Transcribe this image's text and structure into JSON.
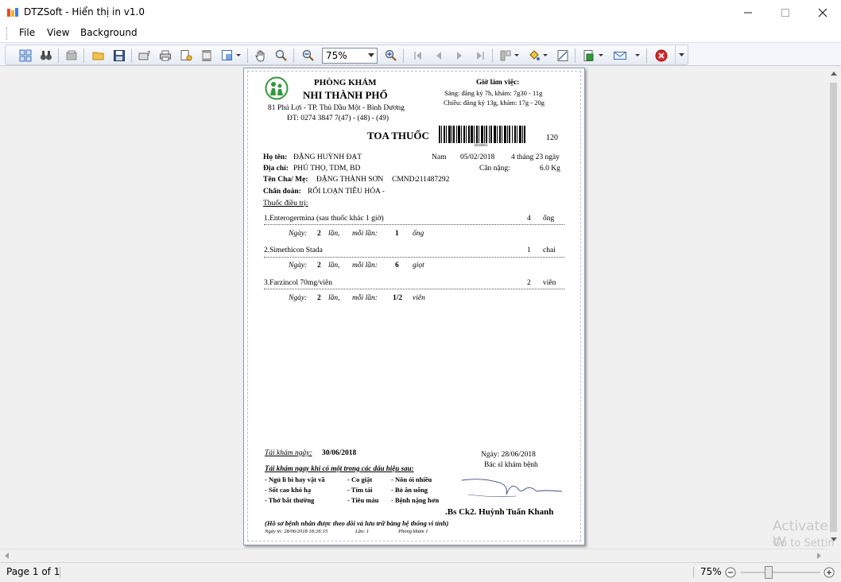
{
  "window": {
    "title": "DTZSoft - Hiển thị in v1.0"
  },
  "menu": {
    "file": "File",
    "view": "View",
    "background": "Background"
  },
  "toolbar": {
    "zoom_value": "75%"
  },
  "clinic": {
    "line1": "PHÒNG KHÁM",
    "line2": "NHI THÀNH PHỐ",
    "address": "81 Phú Lợi - TP. Thủ Dầu Một - Bình Dương",
    "phone": "ĐT: 0274 3847 7(47) - (48) - (49)",
    "hours_title": "Giờ làm việc:",
    "hours_morning": "Sáng: đăng ký 7h, khám: 7g30 - 11g",
    "hours_afternoon": "Chiều: đăng ký 13g, khám: 17g - 20g"
  },
  "prescription": {
    "title": "TOA THUỐC",
    "barcode_text": "1816661",
    "number": "120"
  },
  "patient": {
    "name_label": "Họ tên:",
    "name": "ĐẶNG HUỲNH ĐẠT",
    "gender": "Nam",
    "dob": "05/02/2018",
    "age": "4 tháng 23 ngày",
    "address_label": "Địa chỉ:",
    "address": "PHÚ THỌ, TDM, BD",
    "weight_label": "Cân nặng:",
    "weight": "6.0 Kg",
    "parent_label": "Tên Cha/ Mẹ:",
    "parent": "ĐẶNG THÀNH SƠN",
    "id_label": "CMND:",
    "id": "211487292",
    "diagnosis_label": "Chẩn đoán:",
    "diagnosis": "RỐI LOẠN TIÊU HÓA -",
    "treatment_label": "Thuốc điều trị:"
  },
  "drugs": [
    {
      "name": "1.Enterogermina  (sau thuốc khác 1 giờ)",
      "qty": "4",
      "unit": "ống",
      "day_label": "Ngày:",
      "times": "2",
      "times_label": "lần,",
      "dose_label": "mỗi lần:",
      "dose": "1",
      "dose_unit": "ống"
    },
    {
      "name": "2.Simethicon Stada",
      "qty": "1",
      "unit": "chai",
      "day_label": "Ngày:",
      "times": "2",
      "times_label": "lần,",
      "dose_label": "mỗi lần:",
      "dose": "6",
      "dose_unit": "giọt"
    },
    {
      "name": "3.Farzincol 70mg/viên",
      "qty": "2",
      "unit": "viên",
      "day_label": "Ngày:",
      "times": "2",
      "times_label": "lần,",
      "dose_label": "mỗi lần:",
      "dose": "1/2",
      "dose_unit": "viên"
    }
  ],
  "footer": {
    "recheck_label": "Tái khám ngày:",
    "recheck_date": "30/06/2018",
    "date_line": "Ngày: 28/06/2018",
    "doctor_role": "Bác sĩ khám bệnh",
    "warning_title": "Tái khám ngay khi có một trong các dấu hiệu sau:",
    "signs": [
      [
        "- Ngủ li bì hay vật vã",
        "- Co giật",
        "- Nôn ói nhiều"
      ],
      [
        "- Sốt cao khó hạ",
        "- Tím tái",
        "- Bỏ ăn uống"
      ],
      [
        "- Thở bất thường",
        "- Tiêu máu",
        "- Bệnh nặng hơn"
      ]
    ],
    "doctor_name": ".Bs Ck2. Huỳnh Tuấn Khanh",
    "note": "(Hồ sơ bệnh nhân được theo dõi và lưu trữ bằng hệ thống vi tính)",
    "print_date": "Ngày in: 28/06/2018 18:26:15",
    "print_count": "Lần: 1",
    "room": "Phòng khám 1"
  },
  "status": {
    "page": "Page 1 of 1",
    "zoom": "75%"
  },
  "watermark": {
    "line1": "Activate W",
    "line2": "Go to Settin"
  },
  "colors": {
    "accent_green": "#2e9a3a",
    "stop_red": "#d82a2a"
  }
}
